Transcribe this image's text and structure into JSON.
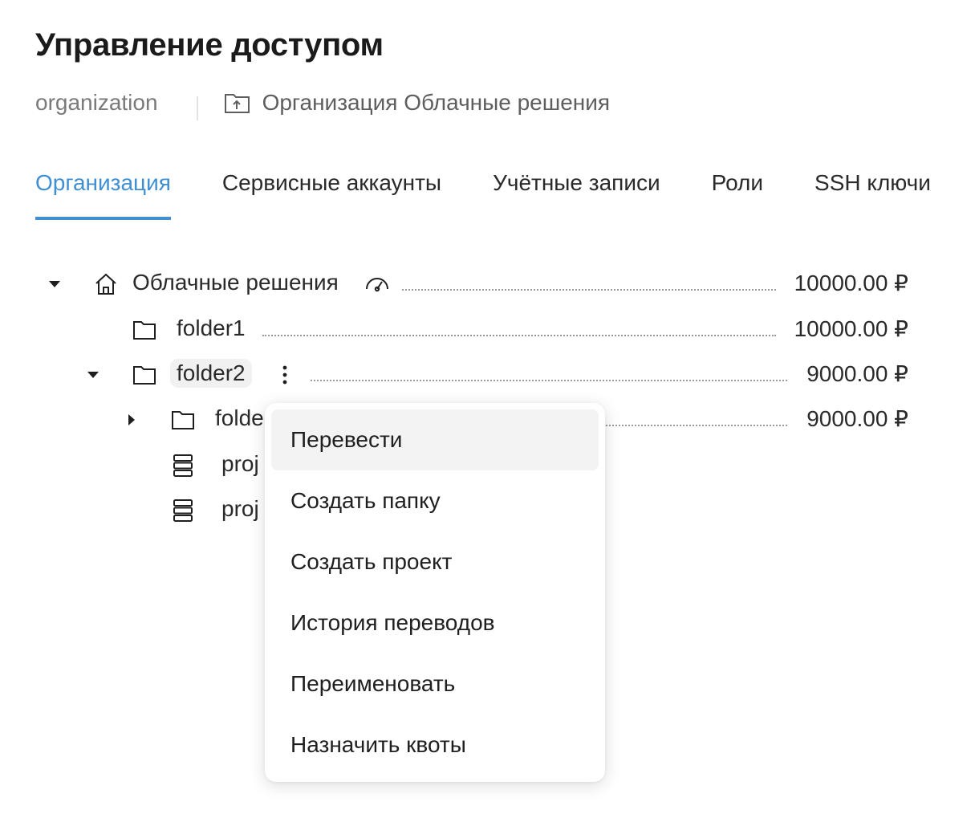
{
  "header": {
    "title": "Управление доступом",
    "org_id": "organization",
    "org_link": "Организация Облачные решения"
  },
  "tabs": [
    {
      "label": "Организация",
      "active": true
    },
    {
      "label": "Сервисные аккаунты",
      "active": false
    },
    {
      "label": "Учётные записи",
      "active": false
    },
    {
      "label": "Роли",
      "active": false
    },
    {
      "label": "SSH ключи",
      "active": false
    }
  ],
  "tree": {
    "root": {
      "label": "Облачные решения",
      "amount": "10000.00 ₽",
      "icon": "home-icon",
      "badge_icon": "speedometer-icon",
      "expanded": true
    },
    "folder1": {
      "label": "folder1",
      "amount": "10000.00 ₽",
      "icon": "folder-icon"
    },
    "folder2": {
      "label": "folder2",
      "amount": "9000.00 ₽",
      "icon": "folder-icon",
      "expanded": true
    },
    "subfolder": {
      "label": "folde",
      "amount": "9000.00 ₽",
      "icon": "folder-icon",
      "expanded": false
    },
    "project1": {
      "label": "proj",
      "icon": "server-icon"
    },
    "project2": {
      "label": "proj",
      "icon": "server-icon"
    }
  },
  "context_menu": {
    "items": [
      {
        "label": "Перевести",
        "hovered": true
      },
      {
        "label": "Создать папку"
      },
      {
        "label": "Создать проект"
      },
      {
        "label": "История переводов"
      },
      {
        "label": "Переименовать"
      },
      {
        "label": "Назначить квоты"
      }
    ]
  },
  "colors": {
    "accent": "#3f8fd2",
    "text": "#2a2a2a",
    "muted": "#7a7a7a"
  }
}
